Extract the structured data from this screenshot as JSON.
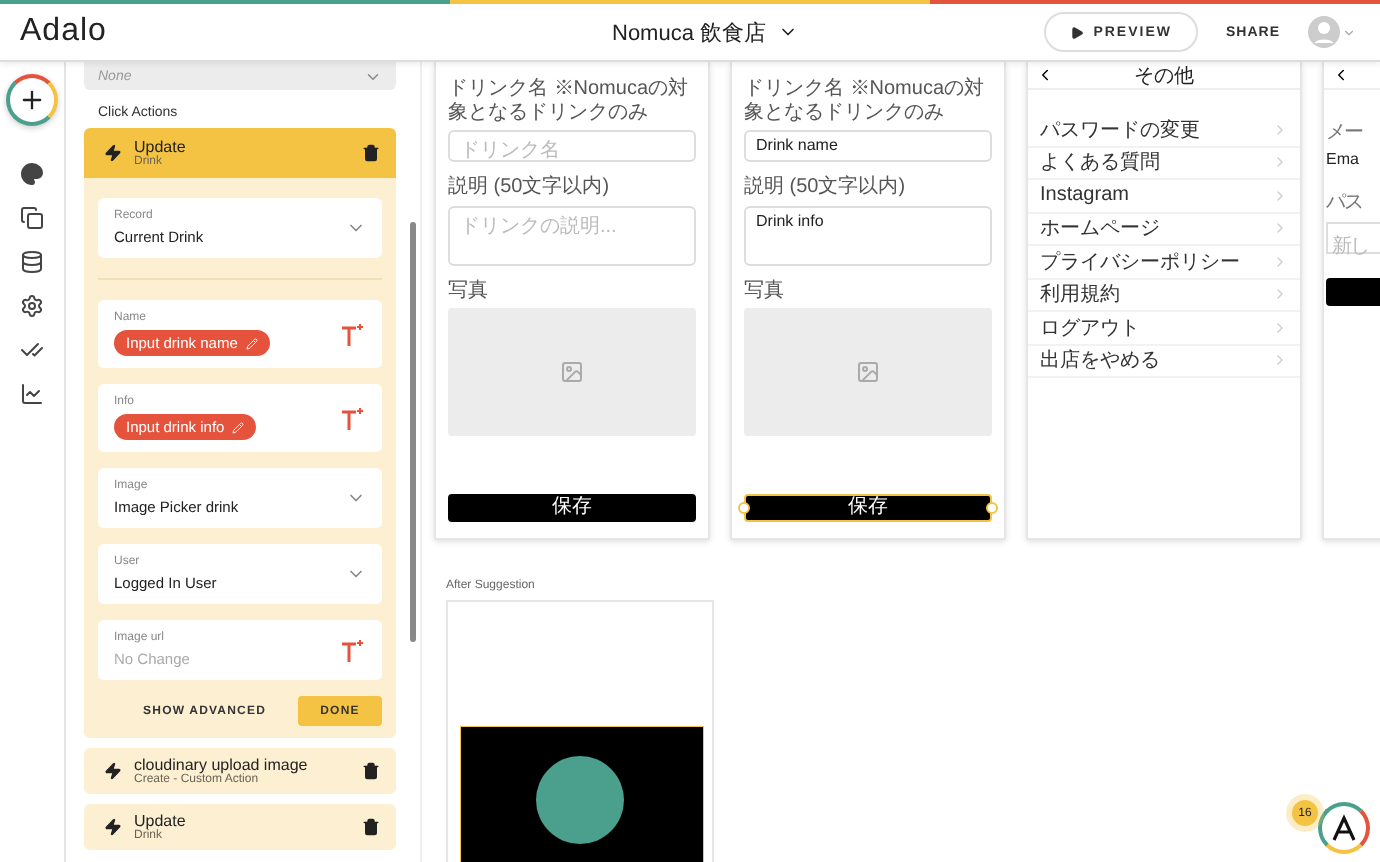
{
  "top_bar": {
    "logo": "Adalo",
    "app_title": "Nomuca 飲食店",
    "preview": "PREVIEW",
    "share": "SHARE"
  },
  "panel": {
    "visibility_dropdown": "None",
    "section_label": "Click Actions",
    "actions": [
      {
        "title": "Update",
        "subtitle": "Drink",
        "expanded": true,
        "fields": [
          {
            "kind": "dropdown",
            "label": "Record",
            "value": "Current Drink"
          },
          {
            "kind": "chip",
            "label": "Name",
            "value": "Input drink name"
          },
          {
            "kind": "chip",
            "label": "Info",
            "value": "Input drink info"
          },
          {
            "kind": "dropdown",
            "label": "Image",
            "value": "Image Picker drink"
          },
          {
            "kind": "dropdown",
            "label": "User",
            "value": "Logged In User"
          },
          {
            "kind": "text",
            "label": "Image url",
            "placeholder": "No Change"
          }
        ],
        "advanced": "SHOW ADVANCED",
        "done": "DONE"
      },
      {
        "title": "cloudinary upload image",
        "subtitle": "Create - Custom Action",
        "expanded": false
      },
      {
        "title": "Update",
        "subtitle": "Drink",
        "expanded": false
      }
    ]
  },
  "screens": [
    {
      "kind": "form",
      "selected": false,
      "fields": [
        {
          "label": "ドリンク名 ※Nomucaの対象となるドリンクのみ",
          "placeholder": "ドリンク名",
          "multiline": false
        },
        {
          "label": "説明 (50文字以内)",
          "placeholder": "ドリンクの説明...",
          "multiline": true
        }
      ],
      "photo_label": "写真",
      "save": "保存"
    },
    {
      "kind": "form",
      "selected": true,
      "fields": [
        {
          "label": "ドリンク名 ※Nomucaの対象となるドリンクのみ",
          "value": "Drink name",
          "multiline": false
        },
        {
          "label": "説明 (50文字以内)",
          "value": "Drink info",
          "multiline": true
        }
      ],
      "photo_label": "写真",
      "save": "保存"
    },
    {
      "kind": "menu",
      "title": "その他",
      "items": [
        "パスワードの変更",
        "よくある質問",
        "Instagram",
        "ホームページ",
        "プライバシーポリシー",
        "利用規約",
        "ログアウト",
        "出店をやめる"
      ]
    },
    {
      "kind": "partial",
      "label": "メー",
      "value": "Ema",
      "field_label": "パス",
      "placeholder": "新し"
    }
  ],
  "suggestion": {
    "label": "After Suggestion",
    "kind": "picture"
  },
  "help": {
    "badge": "16"
  }
}
